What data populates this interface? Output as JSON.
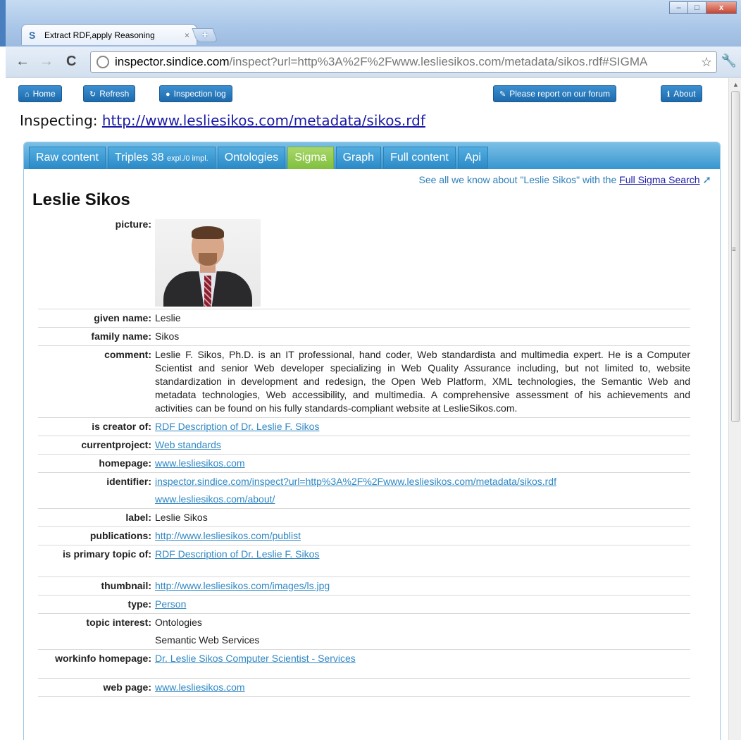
{
  "browser": {
    "tab_title": "Extract RDF,apply Reasoning",
    "tab_close": "×",
    "new_tab": "+",
    "url_host": "inspector.sindice.com",
    "url_path": "/inspect?url=http%3A%2F%2Fwww.lesliesikos.com/metadata/sikos.rdf#SIGMA",
    "window_buttons": [
      "–",
      "□",
      "x"
    ]
  },
  "toolbar": {
    "home": "Home",
    "refresh": "Refresh",
    "inspection_log": "Inspection log",
    "forum": "Please report on our forum",
    "about": "About"
  },
  "inspecting": {
    "label": "Inspecting:",
    "url": "http://www.lesliesikos.com/metadata/sikos.rdf"
  },
  "tabs": {
    "raw": "Raw content",
    "triples_main": "Triples 38 ",
    "triples_expl": "expl./0 impl.",
    "ontologies": "Ontologies",
    "sigma": "Sigma",
    "graph": "Graph",
    "full": "Full content",
    "api": "Api"
  },
  "sigma_note": {
    "text": "See all we know about \"Leslie Sikos\" with the ",
    "link": "Full Sigma Search"
  },
  "person": {
    "name": "Leslie Sikos",
    "labels": {
      "picture": "picture:",
      "given_name": "given name:",
      "family_name": "family name:",
      "comment": "comment:",
      "is_creator_of": "is creator of:",
      "currentproject": "currentproject:",
      "homepage": "homepage:",
      "identifier": "identifier:",
      "label": "label:",
      "publications": "publications:",
      "primary_topic": "is primary topic of:",
      "thumbnail": "thumbnail:",
      "type": "type:",
      "topic_interest": "topic interest:",
      "workinfo": "workinfo homepage:",
      "web_page": "web page:"
    },
    "values": {
      "given_name": "Leslie",
      "family_name": "Sikos",
      "comment": "Leslie F. Sikos, Ph.D. is an IT professional, hand coder, Web standardista and multimedia expert. He is a Computer Scientist and senior Web developer specializing in Web Quality Assurance including, but not limited to, website standardization in development and redesign, the Open Web Platform, XML technologies, the Semantic Web and metadata technologies, Web accessibility, and multimedia. A comprehensive assessment of his achievements and activities can be found on his fully standards-compliant website at LeslieSikos.com.",
      "is_creator_of": "RDF Description of Dr. Leslie F. Sikos",
      "currentproject": "Web standards",
      "homepage": "www.lesliesikos.com",
      "identifier_1": "inspector.sindice.com/inspect?url=http%3A%2F%2Fwww.lesliesikos.com/metadata/sikos.rdf",
      "identifier_2": "www.lesliesikos.com/about/",
      "label": "Leslie Sikos",
      "publications": "http://www.lesliesikos.com/publist",
      "primary_topic": "RDF Description of Dr. Leslie F. Sikos",
      "thumbnail": "http://www.lesliesikos.com/images/ls.jpg",
      "type": "Person",
      "topic_interest_1": "Ontologies",
      "topic_interest_2": "Semantic Web Services",
      "workinfo": "Dr. Leslie Sikos Computer Scientist - Services",
      "web_page": "www.lesliesikos.com"
    }
  },
  "colors": {
    "button_blue": "#1d6aac",
    "tab_blue": "#2a88c6",
    "tab_active_green": "#80bf3e",
    "link_blue": "#3088c4"
  }
}
